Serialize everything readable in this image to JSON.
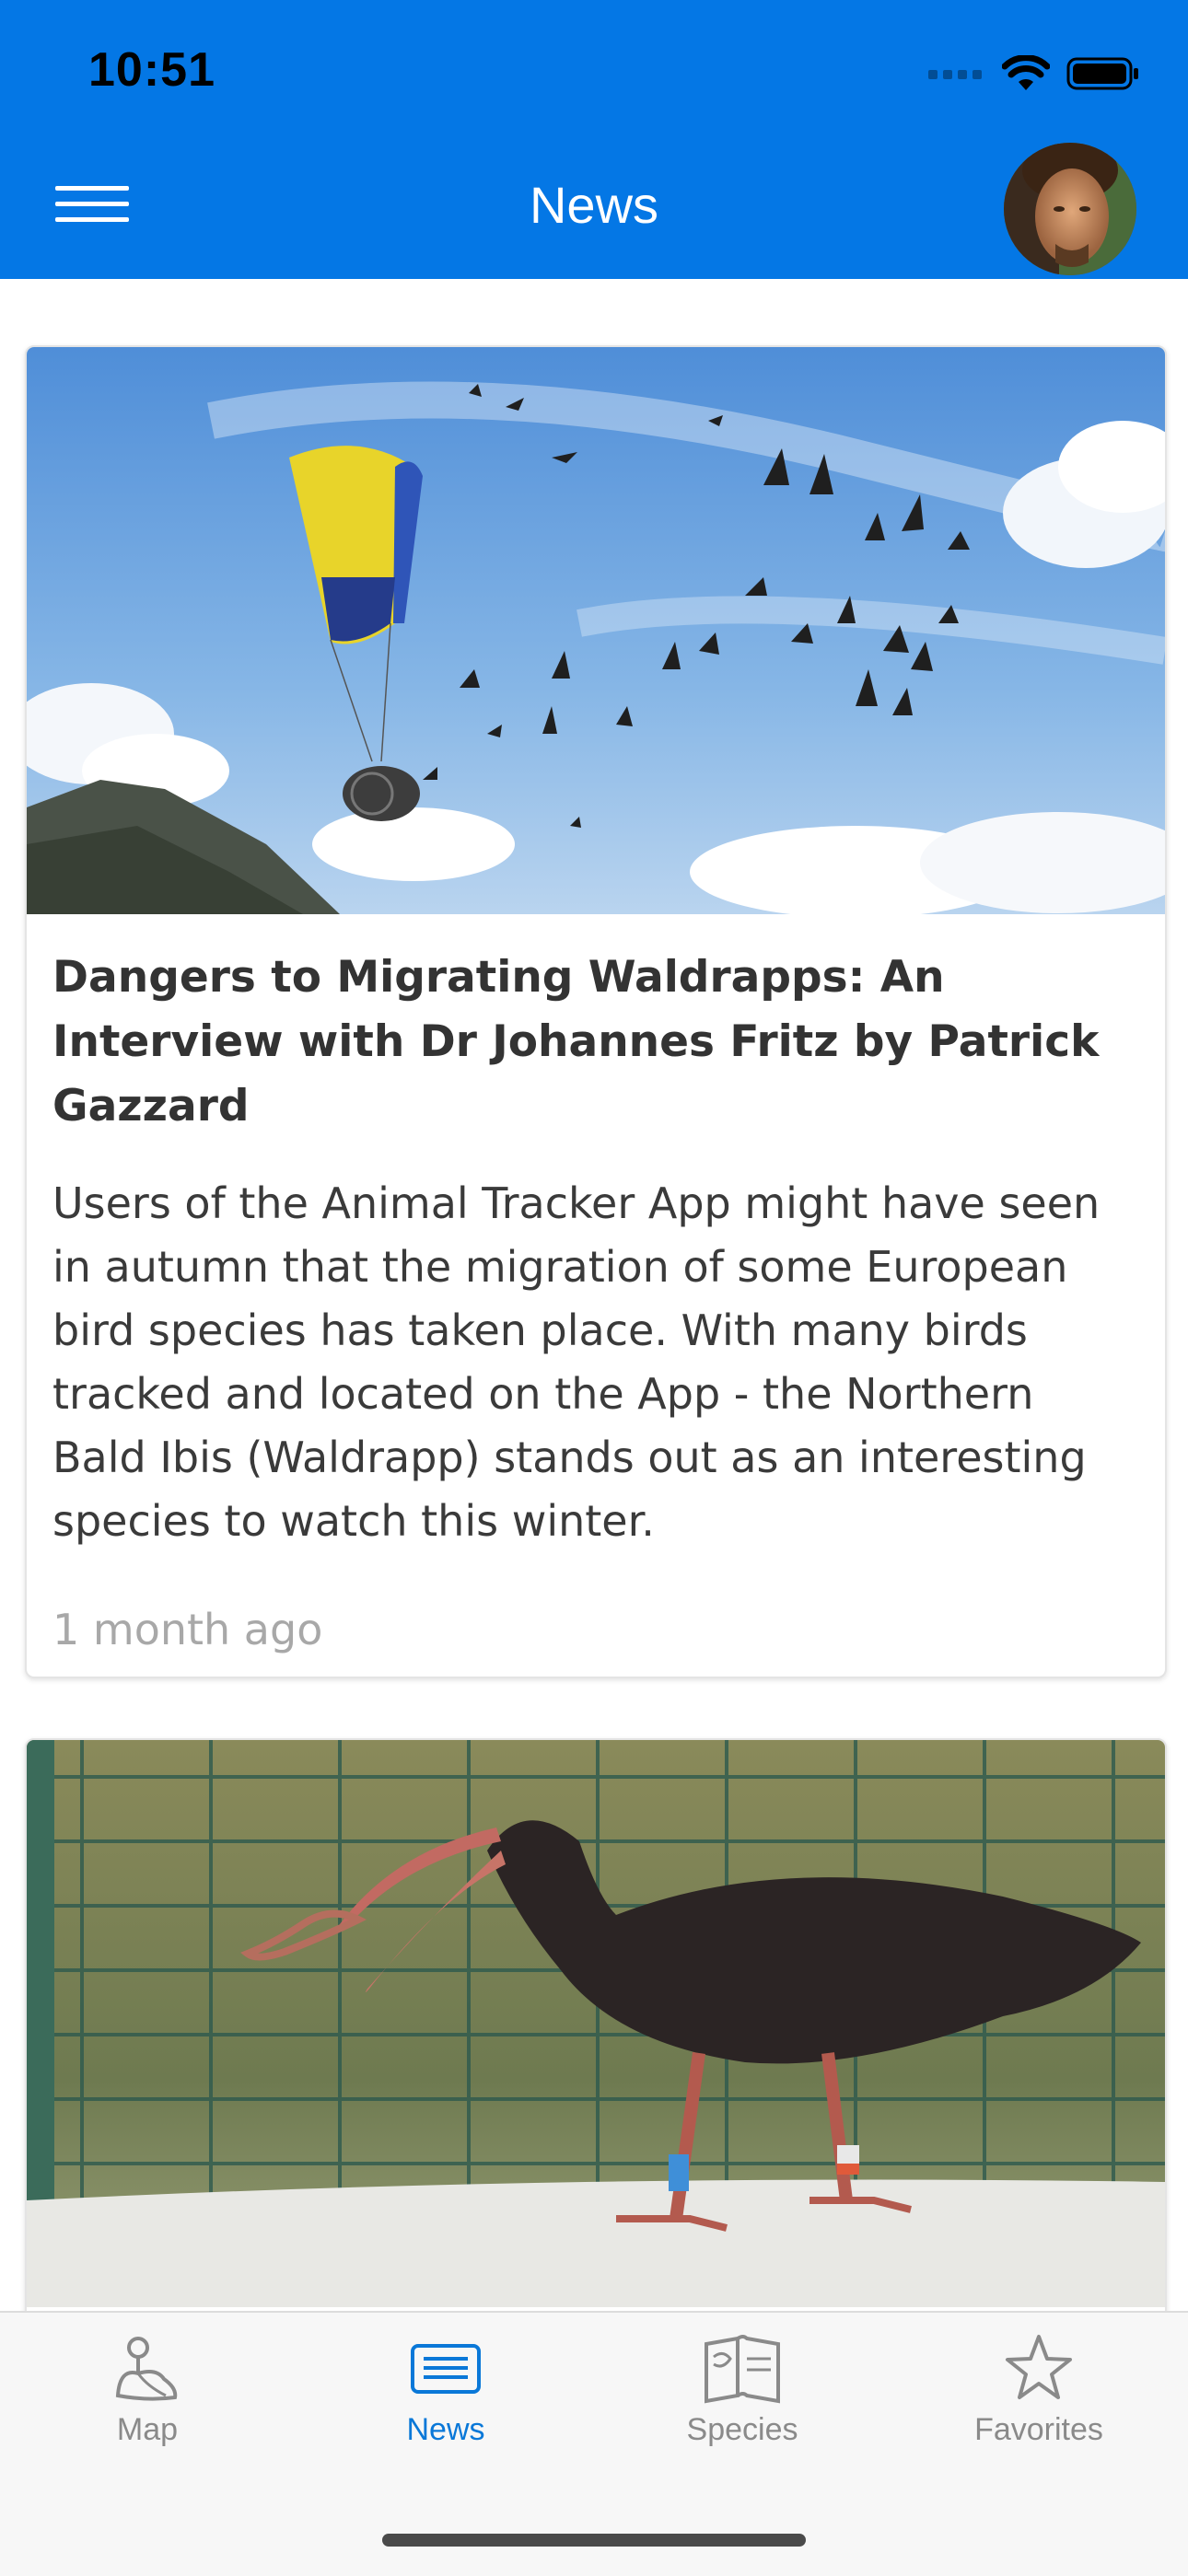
{
  "status_bar": {
    "time": "10:51"
  },
  "header": {
    "title": "News",
    "menu_icon": "hamburger-menu-icon",
    "avatar_icon": "user-avatar"
  },
  "articles": [
    {
      "title": "Dangers to Migrating Waldrapps: An Interview with Dr Johannes Fritz by Patrick Gazzard",
      "body": "Users of the Animal Tracker App might have seen in autumn that the migration of some European bird species has taken place. With many birds tracked and located on the App - the Northern Bald Ibis (Waldrapp) stands out as an interesting species to watch this winter.",
      "time": "1 month ago"
    }
  ],
  "tab_bar": {
    "items": [
      {
        "label": "Map",
        "icon": "map-pin-icon",
        "active": false
      },
      {
        "label": "News",
        "icon": "news-icon",
        "active": true
      },
      {
        "label": "Species",
        "icon": "book-icon",
        "active": false
      },
      {
        "label": "Favorites",
        "icon": "star-icon",
        "active": false
      }
    ]
  },
  "colors": {
    "brand_blue": "#0477e5",
    "active_tab": "#0a78d8",
    "inactive_tab": "#8a8a8a"
  }
}
